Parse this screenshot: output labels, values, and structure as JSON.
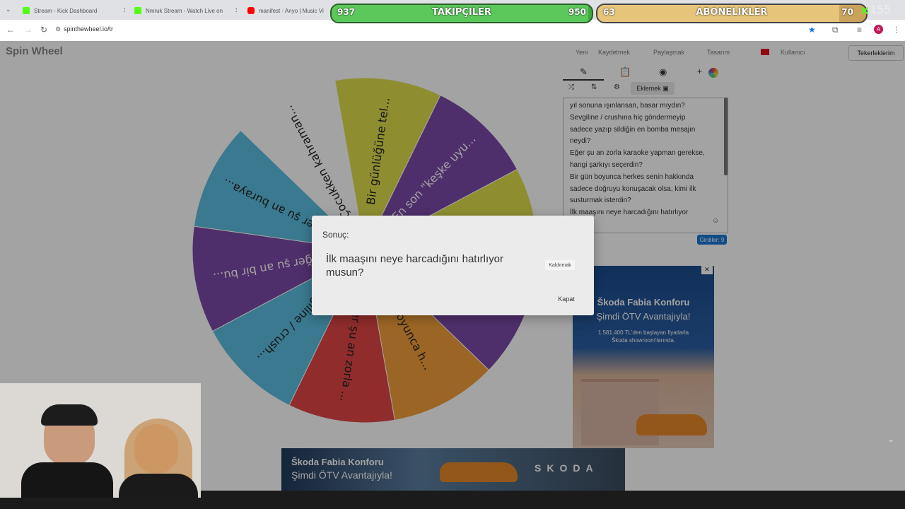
{
  "browser": {
    "tabs": [
      {
        "title": "Stream - Kick Dashboard",
        "favicon_color": "#53fc18"
      },
      {
        "title": "Nmruk Stream - Watch Live on",
        "favicon_color": "#53fc18"
      },
      {
        "title": "manifest - Anyo | Music Vi",
        "favicon_color": "#ff0000"
      }
    ],
    "url": "spinthewheel.io/tr"
  },
  "site": {
    "logo": "Spin Wheel",
    "nav": [
      "Yeni",
      "Kaydetmek",
      "Paylaşmak",
      "Tasarım",
      "Kullanıcı",
      "Tekerleklerim"
    ],
    "language_flag": "tr-flag"
  },
  "panel": {
    "add_label": "Eklemek",
    "entries": [
      "yıl sonuna ışınlansan, basar mıydın?",
      "Sevgiline / crushına hiç göndermeyip",
      "sadece yazıp sildiğin en bomba mesajın",
      "neydi?",
      "Eğer şu an zorla karaoke yapman gerekse,",
      "hangi şarkıyı seçerdin?",
      "Bir gün boyunca herkes senin hakkında",
      "sadece doğruyu konuşacak olsa, kimi ilk",
      "susturmak isterdin?",
      "İlk maaşını neye harcadığını hatırlıyor"
    ],
    "entries_count": "Girdiler: 9"
  },
  "wheel": {
    "segments": [
      {
        "label": "Bir günlüğüne tel...",
        "color": "#dede4e"
      },
      {
        "label": "En son \"keşke uyu...",
        "color": "#7c4aa8"
      },
      {
        "label": "",
        "color": "#dede4e"
      },
      {
        "label": "",
        "color": "#7c4aa8"
      },
      {
        "label": "boyunca h...",
        "color": "#f2a03a"
      },
      {
        "label": "Eğer şu an zorla ...",
        "color": "#e24545"
      },
      {
        "label": "Sevgiline / crush...",
        "color": "#5bbde0"
      },
      {
        "label": "Eğer şu an bir bu...",
        "color": "#7c4aa8"
      },
      {
        "label": "Eğer şu an buraya...",
        "color": "#5bbde0"
      },
      {
        "label": "Çocukken kahraman...",
        "color": "#ffffff"
      }
    ]
  },
  "modal": {
    "title": "Sonuç:",
    "result": "İlk maaşını neye harcadığını hatırlıyor musun?",
    "remove_label": "Kaldırmak",
    "close_label": "Kapat"
  },
  "ads": {
    "right": {
      "title": "Škoda Fabia Konforu",
      "subtitle": "Şimdi ÖTV Avantajıyla!",
      "price_line": "1.581.400 TL'den başlayan fiyatlarla",
      "showroom_line": "Škoda showroom'larında."
    },
    "bottom": {
      "title": "Škoda Fabia Konforu",
      "subtitle": "Şimdi ÖTV Avantajıyla!",
      "brand": "SKODA"
    }
  },
  "stream_overlay": {
    "followers": {
      "label": "TAKIPÇILER",
      "current": "937",
      "goal": "950",
      "progress": 0.986,
      "color": "#5cc85c"
    },
    "subscribers": {
      "label": "ABONELIKLER",
      "current": "63",
      "goal": "70",
      "progress": 0.9,
      "color": "#e6c47a"
    },
    "viewers": "155"
  }
}
